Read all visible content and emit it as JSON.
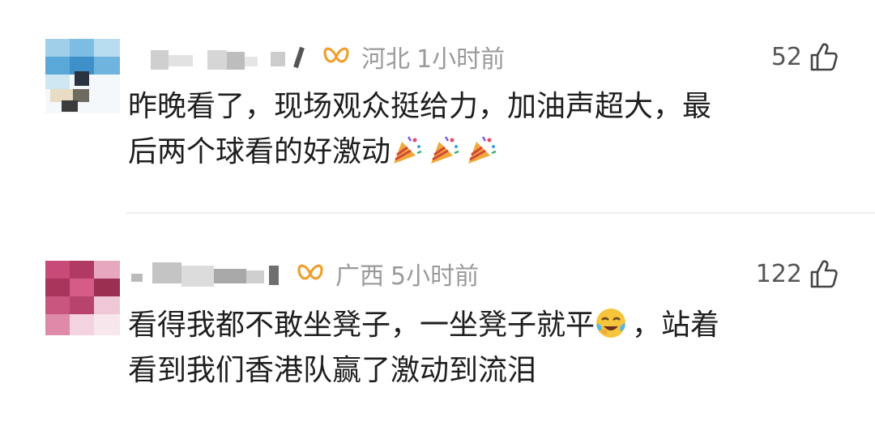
{
  "comments": [
    {
      "location": "河北",
      "time": "1小时前",
      "likes": "52",
      "text_line1": "昨晚看了，现场观众挺给力，加油声超大，最",
      "text_line2": "后两个球看的好激动",
      "emoji": "party-popper",
      "emoji_count": 3
    },
    {
      "location": "广西",
      "time": "5小时前",
      "likes": "122",
      "text_line1a": "看得我都不敢坐凳子，一坐凳子就平",
      "text_line1b": "，站着",
      "text_line2": "看到我们香港队赢了激动到流泪",
      "emoji": "face-with-tears-icon"
    }
  ],
  "colors": {
    "meta_text": "#9a9a9a",
    "badge": "#f0a030",
    "divider": "#efefef"
  }
}
